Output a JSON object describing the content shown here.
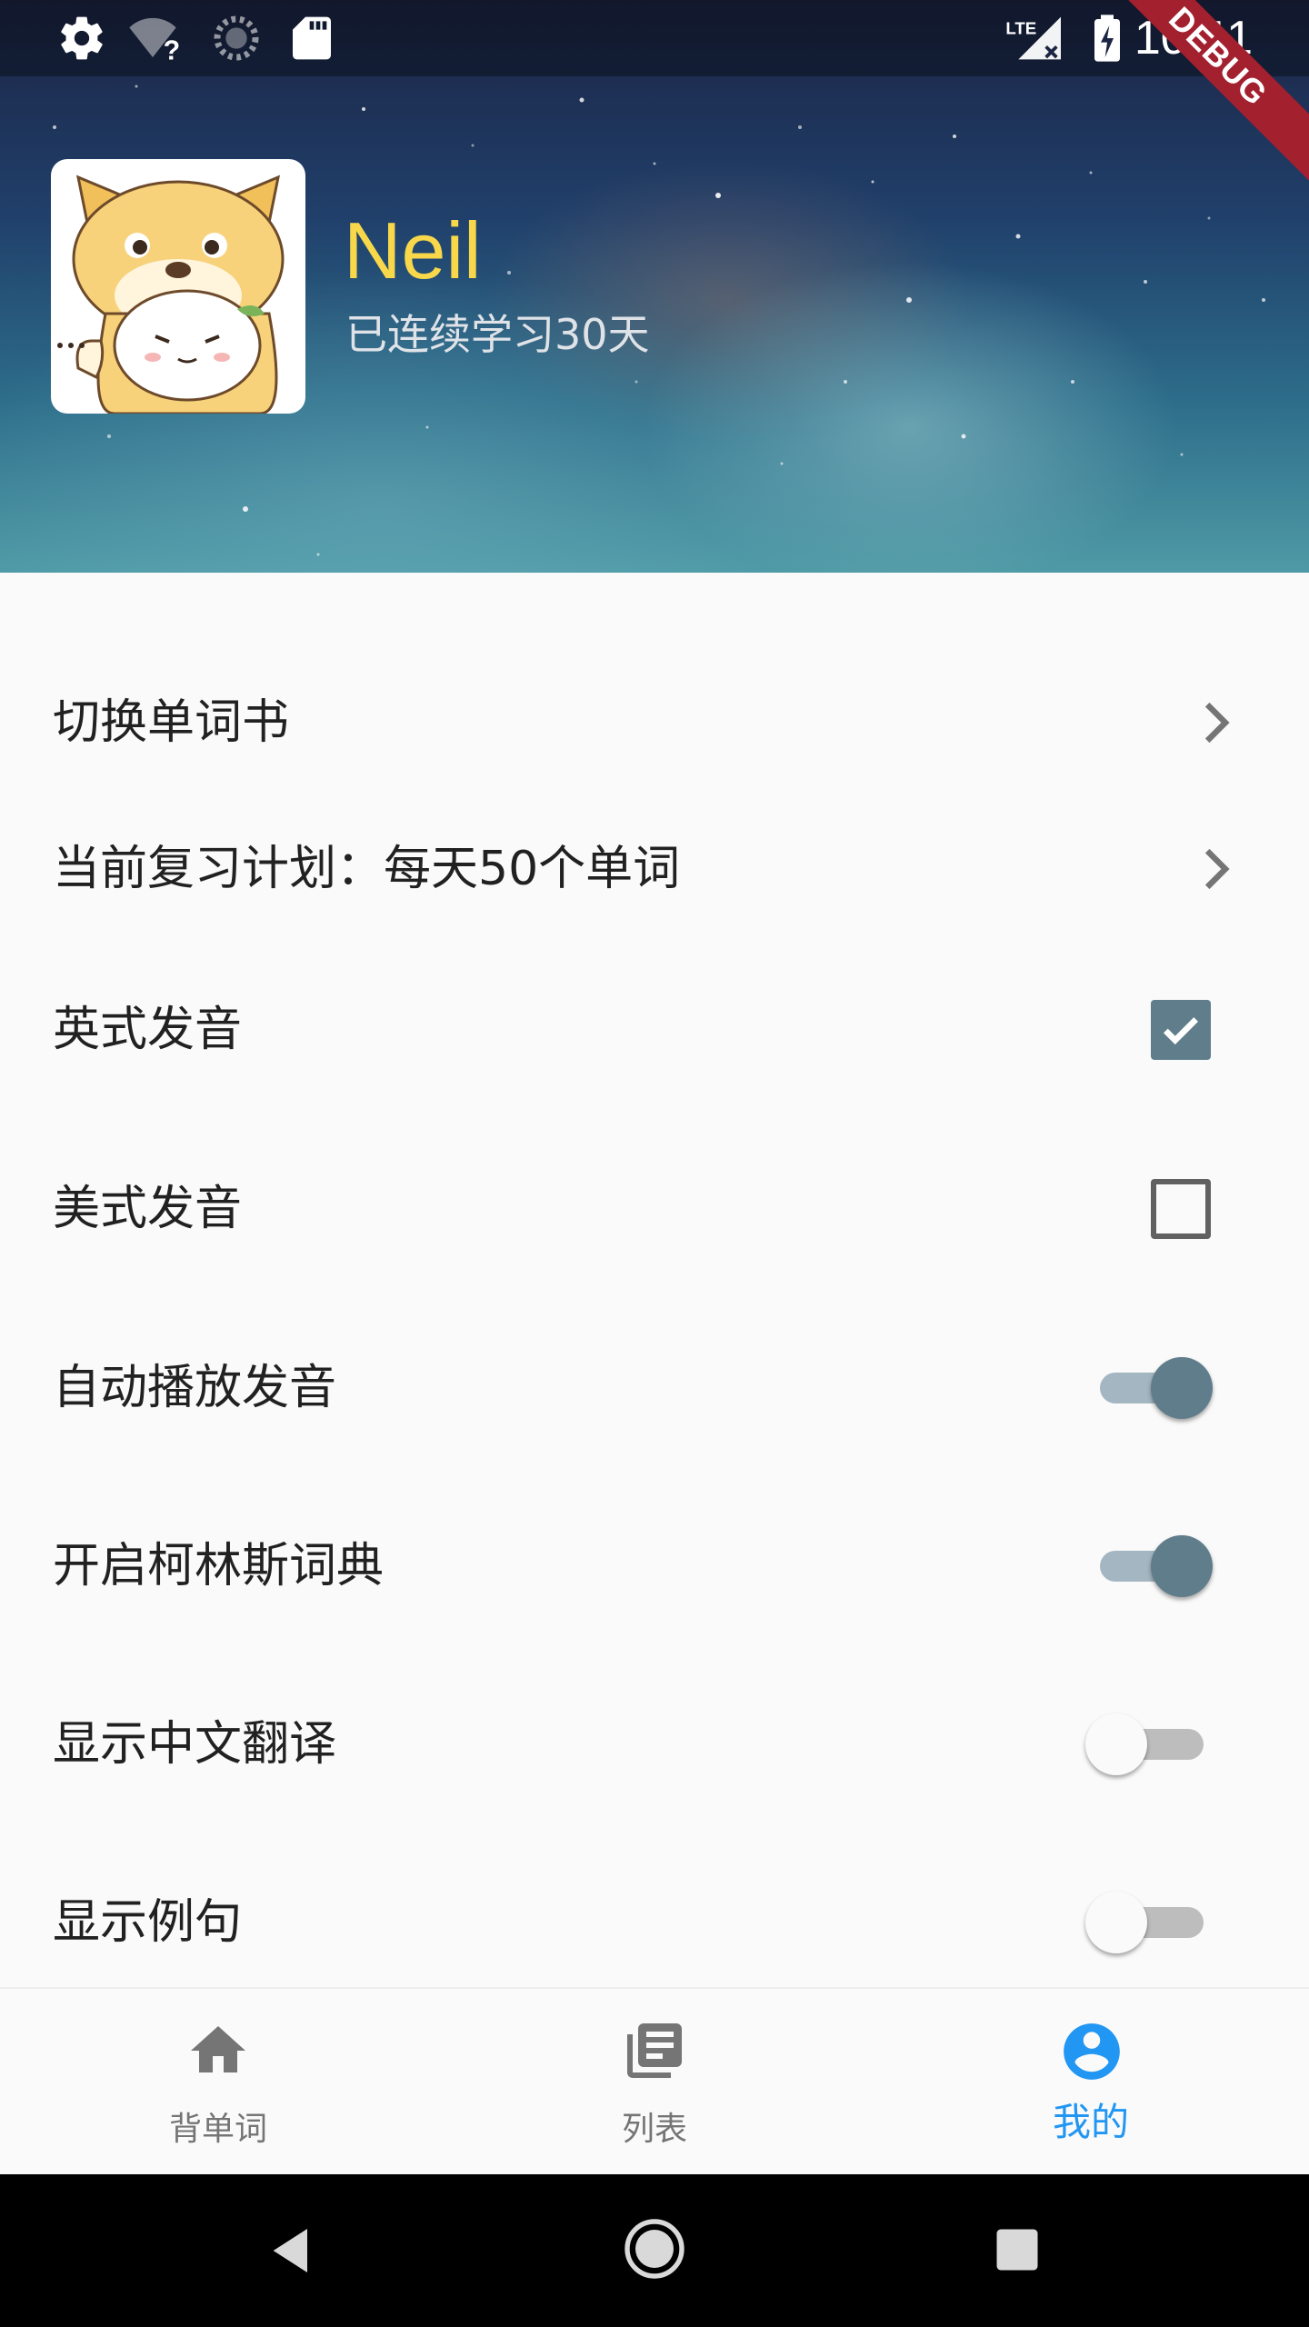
{
  "status_bar": {
    "time": "10:41",
    "network": "LTE",
    "debug_banner": "DEBUG",
    "icons": [
      "gear-icon",
      "wifi-unknown-icon",
      "sync-icon",
      "sd-card-icon",
      "cell-signal-icon",
      "battery-charging-icon"
    ]
  },
  "profile": {
    "name": "Neil",
    "streak": "已连续学习30天"
  },
  "settings": [
    {
      "label": "切换单词书",
      "control": "chevron"
    },
    {
      "label": "当前复习计划：每天50个单词",
      "control": "chevron"
    },
    {
      "label": "英式发音",
      "control": "checkbox",
      "checked": true
    },
    {
      "label": "美式发音",
      "control": "checkbox",
      "checked": false
    },
    {
      "label": "自动播放发音",
      "control": "switch",
      "on": true
    },
    {
      "label": "开启柯林斯词典",
      "control": "switch",
      "on": true
    },
    {
      "label": "显示中文翻译",
      "control": "switch",
      "on": false
    },
    {
      "label": "显示例句",
      "control": "switch",
      "on": false
    }
  ],
  "bottom_nav": {
    "items": [
      {
        "label": "背单词",
        "icon": "home-icon",
        "active": false
      },
      {
        "label": "列表",
        "icon": "library-books-icon",
        "active": false
      },
      {
        "label": "我的",
        "icon": "account-circle-icon",
        "active": true
      }
    ]
  },
  "colors": {
    "accent": "#2196f3",
    "inactive_nav": "#757575",
    "switch_on": "#607d8b",
    "name_text": "#f8d84a"
  }
}
